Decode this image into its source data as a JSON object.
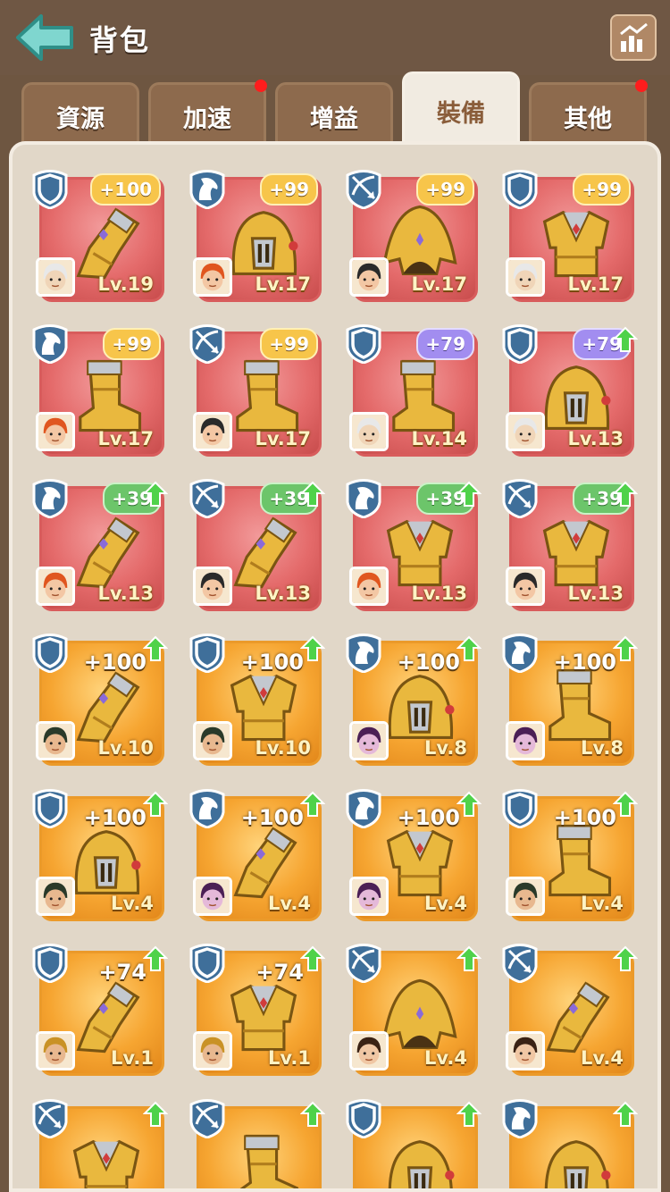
{
  "header": {
    "title": "背包",
    "back_icon": "back-arrow-icon",
    "stats_icon": "stats-chart-icon"
  },
  "tabs": [
    {
      "label": "資源",
      "active": false,
      "dot": false
    },
    {
      "label": "加速",
      "active": false,
      "dot": true
    },
    {
      "label": "增益",
      "active": false,
      "dot": false
    },
    {
      "label": "裝備",
      "active": true,
      "dot": false
    },
    {
      "label": "其他",
      "active": false,
      "dot": true
    }
  ],
  "colors": {
    "red_card": "#e46a6a",
    "orange_card": "#f6a531",
    "notify_dot": "#ff1d1d",
    "badge_gold": "#f7c54a",
    "badge_green": "#6cc56a",
    "badge_purple": "#a28df0"
  },
  "items": [
    {
      "rarity": "red",
      "cls": "shield",
      "gear": "gauntlet",
      "badge": "+100",
      "badge_style": "gold",
      "upgrade": false,
      "hero": "old",
      "level": "Lv.19"
    },
    {
      "rarity": "red",
      "cls": "horse",
      "gear": "helmet",
      "badge": "+99",
      "badge_style": "gold",
      "upgrade": false,
      "hero": "redhair",
      "level": "Lv.17"
    },
    {
      "rarity": "red",
      "cls": "bow",
      "gear": "hood",
      "badge": "+99",
      "badge_style": "gold",
      "upgrade": false,
      "hero": "pirate",
      "level": "Lv.17"
    },
    {
      "rarity": "red",
      "cls": "shield",
      "gear": "chest",
      "badge": "+99",
      "badge_style": "gold",
      "upgrade": false,
      "hero": "old",
      "level": "Lv.17"
    },
    {
      "rarity": "red",
      "cls": "horse",
      "gear": "boot",
      "badge": "+99",
      "badge_style": "gold",
      "upgrade": false,
      "hero": "redhair",
      "level": "Lv.17"
    },
    {
      "rarity": "red",
      "cls": "bow",
      "gear": "boot",
      "badge": "+99",
      "badge_style": "gold",
      "upgrade": false,
      "hero": "pirate",
      "level": "Lv.17"
    },
    {
      "rarity": "red",
      "cls": "shield",
      "gear": "boot",
      "badge": "+79",
      "badge_style": "purple",
      "upgrade": false,
      "hero": "old",
      "level": "Lv.14"
    },
    {
      "rarity": "red",
      "cls": "shield",
      "gear": "helmet",
      "badge": "+79",
      "badge_style": "purple",
      "upgrade": true,
      "hero": "old",
      "level": "Lv.13"
    },
    {
      "rarity": "red",
      "cls": "horse",
      "gear": "gauntlet",
      "badge": "+39",
      "badge_style": "green",
      "upgrade": true,
      "hero": "redhair",
      "level": "Lv.13"
    },
    {
      "rarity": "red",
      "cls": "bow",
      "gear": "gauntlet",
      "badge": "+39",
      "badge_style": "green",
      "upgrade": true,
      "hero": "pirate",
      "level": "Lv.13"
    },
    {
      "rarity": "red",
      "cls": "horse",
      "gear": "chest",
      "badge": "+39",
      "badge_style": "green",
      "upgrade": true,
      "hero": "redhair",
      "level": "Lv.13"
    },
    {
      "rarity": "red",
      "cls": "bow",
      "gear": "chest",
      "badge": "+39",
      "badge_style": "green",
      "upgrade": true,
      "hero": "pirate",
      "level": "Lv.13"
    },
    {
      "rarity": "orange",
      "cls": "shield",
      "gear": "gauntlet",
      "badge": "+100",
      "badge_style": "plain",
      "upgrade": true,
      "hero": "boy",
      "level": "Lv.10"
    },
    {
      "rarity": "orange",
      "cls": "shield",
      "gear": "chest",
      "badge": "+100",
      "badge_style": "plain",
      "upgrade": true,
      "hero": "boy",
      "level": "Lv.10"
    },
    {
      "rarity": "orange",
      "cls": "horse",
      "gear": "helmet",
      "badge": "+100",
      "badge_style": "plain",
      "upgrade": true,
      "hero": "purplehair",
      "level": "Lv.8"
    },
    {
      "rarity": "orange",
      "cls": "horse",
      "gear": "boot",
      "badge": "+100",
      "badge_style": "plain",
      "upgrade": true,
      "hero": "purplehair",
      "level": "Lv.8"
    },
    {
      "rarity": "orange",
      "cls": "shield",
      "gear": "helmet",
      "badge": "+100",
      "badge_style": "plain",
      "upgrade": true,
      "hero": "boy",
      "level": "Lv.4"
    },
    {
      "rarity": "orange",
      "cls": "horse",
      "gear": "gauntlet",
      "badge": "+100",
      "badge_style": "plain",
      "upgrade": true,
      "hero": "purplehair",
      "level": "Lv.4"
    },
    {
      "rarity": "orange",
      "cls": "horse",
      "gear": "chest",
      "badge": "+100",
      "badge_style": "plain",
      "upgrade": true,
      "hero": "purplehair",
      "level": "Lv.4"
    },
    {
      "rarity": "orange",
      "cls": "shield",
      "gear": "boot",
      "badge": "+100",
      "badge_style": "plain",
      "upgrade": true,
      "hero": "boy",
      "level": "Lv.4"
    },
    {
      "rarity": "orange",
      "cls": "shield",
      "gear": "gauntlet",
      "badge": "+74",
      "badge_style": "plain",
      "upgrade": true,
      "hero": "spartan",
      "level": "Lv.1"
    },
    {
      "rarity": "orange",
      "cls": "shield",
      "gear": "chest",
      "badge": "+74",
      "badge_style": "plain",
      "upgrade": true,
      "hero": "spartan",
      "level": "Lv.1"
    },
    {
      "rarity": "orange",
      "cls": "bow",
      "gear": "hood",
      "badge": "",
      "badge_style": "plain",
      "upgrade": true,
      "hero": "girl",
      "level": "Lv.4"
    },
    {
      "rarity": "orange",
      "cls": "bow",
      "gear": "gauntlet",
      "badge": "",
      "badge_style": "plain",
      "upgrade": true,
      "hero": "girl",
      "level": "Lv.4"
    },
    {
      "rarity": "orange",
      "cls": "bow",
      "gear": "chest",
      "badge": "",
      "badge_style": "plain",
      "upgrade": true,
      "hero": "",
      "level": ""
    },
    {
      "rarity": "orange",
      "cls": "bow",
      "gear": "boot",
      "badge": "",
      "badge_style": "plain",
      "upgrade": true,
      "hero": "",
      "level": ""
    },
    {
      "rarity": "orange",
      "cls": "shield",
      "gear": "helmet",
      "badge": "",
      "badge_style": "plain",
      "upgrade": true,
      "hero": "",
      "level": ""
    },
    {
      "rarity": "orange",
      "cls": "horse",
      "gear": "helmet",
      "badge": "",
      "badge_style": "plain",
      "upgrade": true,
      "hero": "",
      "level": ""
    }
  ]
}
